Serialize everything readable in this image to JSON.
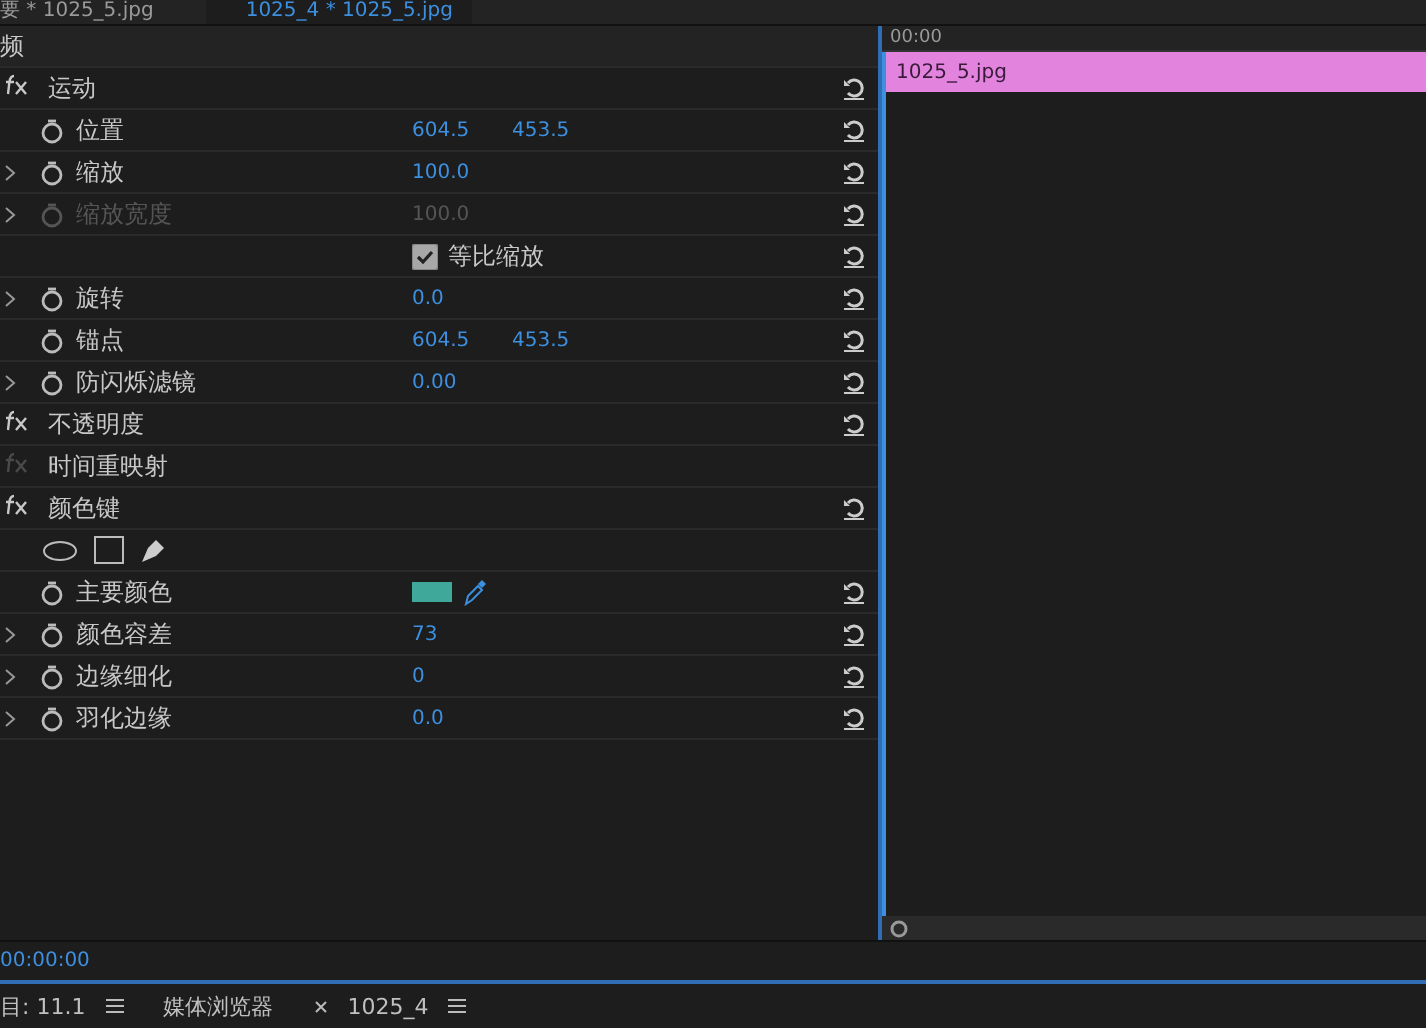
{
  "tabs": [
    {
      "label": "要 * 1025_5.jpg",
      "selected": false
    },
    {
      "label": "1025_4 * 1025_5.jpg",
      "selected": true
    }
  ],
  "section_header": {
    "label": "频"
  },
  "effects": [
    {
      "kind": "section",
      "label": "运动",
      "fx_enabled": true,
      "resettable": true
    },
    {
      "kind": "property",
      "label": "位置",
      "expandable": false,
      "disabled": false,
      "values": [
        "604.5",
        "453.5"
      ]
    },
    {
      "kind": "property",
      "label": "缩放",
      "expandable": true,
      "disabled": false,
      "values": [
        "100.0"
      ]
    },
    {
      "kind": "property",
      "label": "缩放宽度",
      "expandable": true,
      "disabled": true,
      "values": [
        "100.0"
      ]
    },
    {
      "kind": "checkbox",
      "label": "等比缩放",
      "checked": true
    },
    {
      "kind": "property",
      "label": "旋转",
      "expandable": true,
      "disabled": false,
      "values": [
        "0.0"
      ]
    },
    {
      "kind": "property",
      "label": "锚点",
      "expandable": false,
      "disabled": false,
      "values": [
        "604.5",
        "453.5"
      ]
    },
    {
      "kind": "property",
      "label": "防闪烁滤镜",
      "expandable": true,
      "disabled": false,
      "values": [
        "0.00"
      ]
    },
    {
      "kind": "section",
      "label": "不透明度",
      "fx_enabled": true,
      "resettable": true
    },
    {
      "kind": "section",
      "label": "时间重映射",
      "fx_enabled": false,
      "resettable": false
    },
    {
      "kind": "section",
      "label": "颜色键",
      "fx_enabled": true,
      "resettable": true
    },
    {
      "kind": "tools"
    },
    {
      "kind": "color",
      "label": "主要颜色",
      "color": "#3fa89a"
    },
    {
      "kind": "property",
      "label": "颜色容差",
      "expandable": true,
      "disabled": false,
      "values": [
        "73"
      ]
    },
    {
      "kind": "property",
      "label": "边缘细化",
      "expandable": true,
      "disabled": false,
      "values": [
        "0"
      ]
    },
    {
      "kind": "property",
      "label": "羽化边缘",
      "expandable": true,
      "disabled": false,
      "values": [
        "0.0"
      ]
    }
  ],
  "timeline": {
    "ruler_label": "00:00",
    "clip": {
      "label": "1025_5.jpg"
    }
  },
  "current_time": "00:00:00",
  "bottom_tabs": [
    {
      "label": "目: 11.1",
      "closable": false,
      "menu": true
    },
    {
      "label": "媒体浏览器",
      "closable": false,
      "menu": false
    },
    {
      "label": "1025_4",
      "closable": true,
      "menu": true
    }
  ]
}
